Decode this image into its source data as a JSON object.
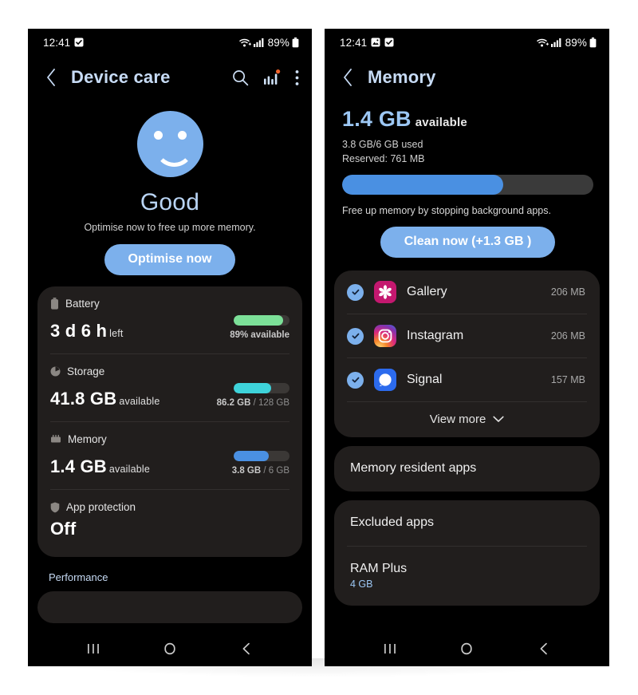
{
  "statusbar": {
    "time": "12:41",
    "battery_percent": "89%",
    "icons_left_phone": [
      "checkbox-icon"
    ],
    "icons_right_phone": [
      "image-icon",
      "checkbox-icon"
    ],
    "icons_right_side": [
      "wifi-icon",
      "signal-icon",
      "battery-icon"
    ]
  },
  "left": {
    "appbar": {
      "title": "Device care",
      "back_icon": "chevron-left-icon",
      "search_icon": "search-icon",
      "chart_icon": "bar-chart-icon",
      "more_icon": "overflow-menu-icon",
      "badge_color": "#f0622a"
    },
    "hero": {
      "face_icon": "smiley-face-icon",
      "status": "Good",
      "subtitle": "Optimise now to free up more memory.",
      "button_label": "Optimise now",
      "accent": "#7cb0ec"
    },
    "cards": [
      {
        "name": "battery",
        "icon": "battery-icon",
        "label": "Battery",
        "value": "3 d 6 h",
        "unit": "left",
        "bar_percent": 89,
        "bar_color": "#7ce098",
        "caption": "89% available",
        "caption_muted": ""
      },
      {
        "name": "storage",
        "icon": "pie-chart-icon",
        "label": "Storage",
        "value": "41.8 GB",
        "unit": "available",
        "bar_percent": 67,
        "bar_color": "#3ed3da",
        "caption": "86.2 GB",
        "caption_muted": "/ 128 GB"
      },
      {
        "name": "memory",
        "icon": "memory-chip-icon",
        "label": "Memory",
        "value": "1.4 GB",
        "unit": "available",
        "bar_percent": 63,
        "bar_color": "#4a90e2",
        "caption": "3.8 GB",
        "caption_muted": "/ 6 GB"
      },
      {
        "name": "app-protection",
        "icon": "shield-icon",
        "label": "App protection",
        "value": "Off",
        "unit": "",
        "bar_percent": 0,
        "bar_color": "",
        "caption": "",
        "caption_muted": ""
      }
    ],
    "section_label": "Performance"
  },
  "right": {
    "appbar": {
      "title": "Memory",
      "back_icon": "chevron-left-icon"
    },
    "memory": {
      "available_value": "1.4 GB",
      "available_word": "available",
      "used_line": "3.8 GB/6 GB used",
      "reserved_line": "Reserved: 761 MB",
      "bar_percent": 64,
      "bar_color": "#4a90e2",
      "hint": "Free up memory by stopping background apps.",
      "clean_button": "Clean now (+1.3 GB )"
    },
    "apps": [
      {
        "name": "Gallery",
        "size": "206 MB",
        "checked": true,
        "icon": "gallery-app-icon",
        "color": "#c4186f"
      },
      {
        "name": "Instagram",
        "size": "206 MB",
        "checked": true,
        "icon": "instagram-app-icon",
        "color": "#e1306c"
      },
      {
        "name": "Signal",
        "size": "157 MB",
        "checked": true,
        "icon": "signal-app-icon",
        "color": "#2c6bed"
      }
    ],
    "view_more": "View more",
    "view_more_icon": "chevron-down-icon",
    "menu": [
      {
        "label": "Memory resident apps",
        "sub": ""
      },
      {
        "label": "Excluded apps",
        "sub": ""
      },
      {
        "label": "RAM Plus",
        "sub": "4 GB"
      }
    ]
  },
  "navbar": {
    "recents_icon": "recents-icon",
    "home_icon": "home-icon",
    "back_icon": "back-icon"
  }
}
